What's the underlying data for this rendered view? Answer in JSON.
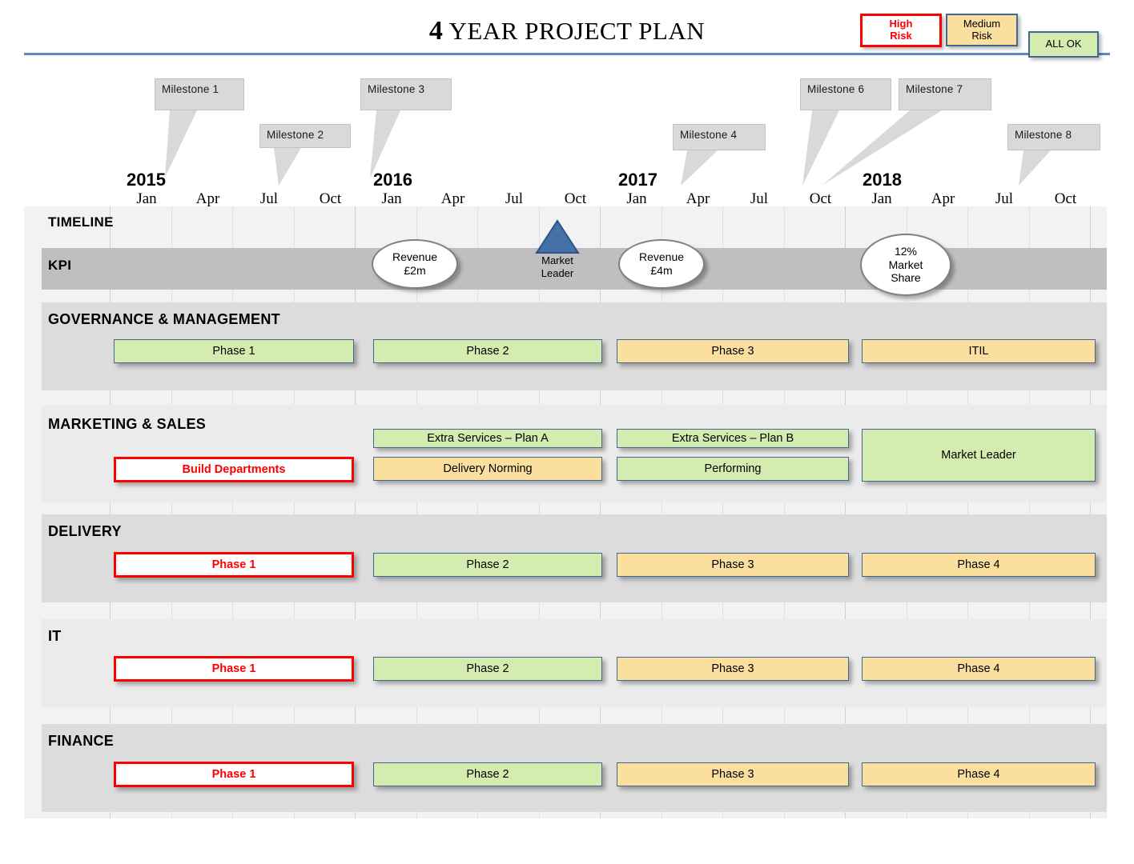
{
  "header": {
    "title_number": "4",
    "title_rest": " YEAR PROJECT PLAN",
    "rule_color": "#5b8ac6"
  },
  "legend": {
    "items": [
      {
        "label": "High\nRisk",
        "line1": "High",
        "line2": "Risk",
        "fill": "#ffffff",
        "border": "#ff0000",
        "text": "#ff0000"
      },
      {
        "label": "Medium Risk",
        "line1": "Medium",
        "line2": "Risk",
        "fill": "#fadf9e",
        "border": "#41688f",
        "text": "#000000"
      },
      {
        "label": "ALL OK",
        "line1": "ALL OK",
        "line2": "",
        "fill": "#d5ecb0",
        "border": "#41688f",
        "text": "#000000"
      }
    ]
  },
  "milestones": [
    {
      "label": "Milestone  1"
    },
    {
      "label": "Milestone  2"
    },
    {
      "label": "Milestone  3"
    },
    {
      "label": "Milestone  4"
    },
    {
      "label": "Milestone  6"
    },
    {
      "label": "Milestone  7"
    },
    {
      "label": "Milestone  8"
    }
  ],
  "timeline": {
    "years": [
      "2015",
      "2016",
      "2017",
      "2018"
    ],
    "quarters": [
      "Jan",
      "Apr",
      "Jul",
      "Oct"
    ],
    "quarter_labels": [
      "Jan",
      "Apr",
      "Jul",
      "Oct",
      "Jan",
      "Apr",
      "Jul",
      "Oct",
      "Jan",
      "Apr",
      "Jul",
      "Oct",
      "Jan",
      "Apr",
      "Jul",
      "Oct"
    ]
  },
  "rows": {
    "timeline_label": "TIMELINE",
    "kpi_label": "KPI",
    "governance_label": "GOVERNANCE  & MANAGEMENT",
    "marketing_label": "MARKETING  & SALES",
    "delivery_label": "DELIVERY",
    "it_label": "IT",
    "finance_label": "FINANCE"
  },
  "kpi": {
    "revenue_2m_l1": "Revenue",
    "revenue_2m_l2": "£2m",
    "revenue_4m_l1": "Revenue",
    "revenue_4m_l2": "£4m",
    "market_share_l1": "12%",
    "market_share_l2": "Market",
    "market_share_l3": "Share",
    "market_leader_l1": "Market",
    "market_leader_l2": "Leader",
    "triangle_color": "#4472a8"
  },
  "bars": {
    "gov": [
      "Phase 1",
      "Phase 2",
      "Phase 3",
      "ITIL"
    ],
    "mkt_top": [
      "Extra Services – Plan A",
      "Extra Services – Plan B"
    ],
    "mkt_bottom": [
      "Build Departments",
      "Delivery Norming",
      "Performing"
    ],
    "mkt_tall": "Market Leader",
    "delivery": [
      "Phase 1",
      "Phase 2",
      "Phase 3",
      "Phase 4"
    ],
    "it": [
      "Phase 1",
      "Phase 2",
      "Phase 3",
      "Phase 4"
    ],
    "finance": [
      "Phase 1",
      "Phase 2",
      "Phase 3",
      "Phase 4"
    ]
  },
  "colors": {
    "green": "#d5ecb0",
    "amber": "#fadf9e",
    "red": "#ff0000",
    "bar_border": "#41688f",
    "kpi_band": "#bfbfbf",
    "band_dark": "#dcdcdc",
    "band_light": "#ebebeb",
    "chart_bg": "#f2f2f2"
  }
}
